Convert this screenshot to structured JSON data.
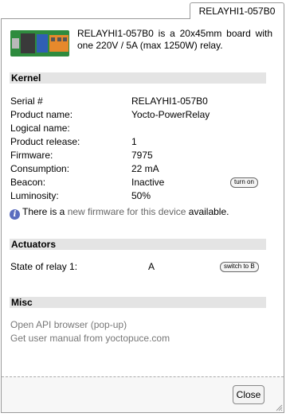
{
  "tab": {
    "label": "RELAYHI1-057B0"
  },
  "intro": {
    "text": "RELAYHI1-057B0 is a 20x45mm board with one 220V / 5A (max 1250W) relay."
  },
  "kernel": {
    "title": "Kernel",
    "rows": [
      {
        "label": "Serial #",
        "value": "RELAYHI1-057B0"
      },
      {
        "label": "Product name:",
        "value": "Yocto-PowerRelay"
      },
      {
        "label": "Logical name:",
        "value": ""
      },
      {
        "label": "Product release:",
        "value": "1"
      },
      {
        "label": "Firmware:",
        "value": "7975"
      },
      {
        "label": "Consumption:",
        "value": "22 mA"
      },
      {
        "label": "Beacon:",
        "value": "Inactive",
        "button": "turn on"
      },
      {
        "label": "Luminosity:",
        "value": "50%"
      }
    ],
    "firmware_notice": {
      "prefix": "There is a",
      "link": "new firmware for this device",
      "suffix": "available."
    }
  },
  "actuators": {
    "title": "Actuators",
    "rows": [
      {
        "label": "State of relay 1:",
        "value": "A",
        "button": "switch to B"
      }
    ]
  },
  "misc": {
    "title": "Misc",
    "links": [
      "Open API browser (pop-up)",
      "Get user manual from yoctopuce.com"
    ]
  },
  "footer": {
    "close_label": "Close"
  },
  "colors": {
    "section_bg": "#e4e4e4",
    "info_icon": "#5b6dbf",
    "board_green": "#2e8b3e",
    "relay_blue": "#2f5fb5",
    "terminal_orange": "#e6892c"
  },
  "icons": {
    "info": "info-icon",
    "device": "device-image",
    "resize": "resize-grip-icon"
  }
}
